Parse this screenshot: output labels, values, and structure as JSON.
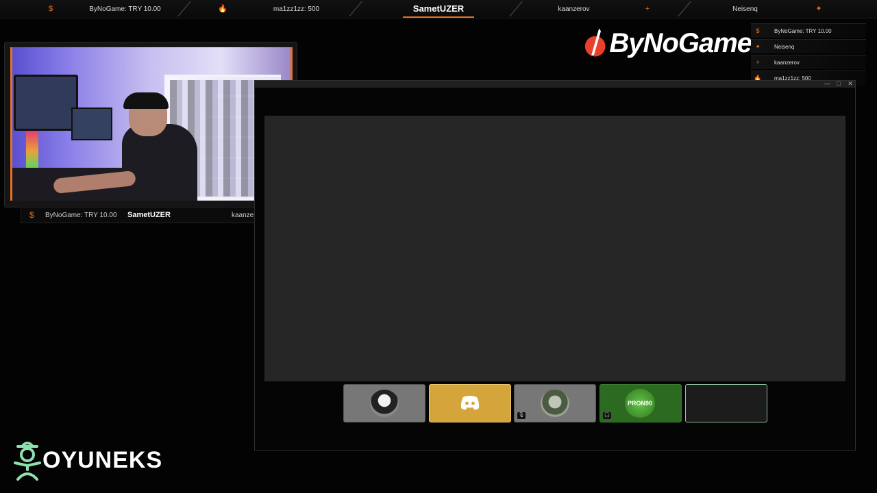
{
  "topbar": {
    "items": [
      {
        "icon": "$",
        "text": "ByNoGame: TRY 10.00"
      },
      {
        "icon": "🔥",
        "text": "ma1zz1zz: 500"
      },
      {
        "text": "SametUZER"
      },
      {
        "icon": "+",
        "text": "kaanzerov"
      },
      {
        "icon": "✦",
        "text": "Neisenq"
      }
    ],
    "accent": "#e8731f"
  },
  "brand_logo": {
    "text": "ByNoGame"
  },
  "events": [
    {
      "icon": "$",
      "text": "ByNoGame: TRY 10.00"
    },
    {
      "icon": "✦",
      "text": "Neisenq"
    },
    {
      "icon": "+",
      "text": "kaanzerov"
    },
    {
      "icon": "🔥",
      "text": "ma1zz1zz: 500"
    }
  ],
  "webcam": {
    "bar": {
      "donation": "ByNoGame: TRY 10.00",
      "name": "SametUZER",
      "follower": "kaanzerov"
    }
  },
  "window": {
    "controls": [
      "—",
      "□",
      "✕"
    ],
    "participants": [
      {
        "type": "avatar",
        "muted": false
      },
      {
        "type": "discord",
        "muted": false
      },
      {
        "type": "avatar",
        "muted": true
      },
      {
        "type": "avatar",
        "label": "PRON90",
        "muted": true
      },
      {
        "type": "empty",
        "muted": false
      }
    ]
  },
  "watermark": {
    "text": "OYUNEKS",
    "color": "#8fe0b0"
  }
}
